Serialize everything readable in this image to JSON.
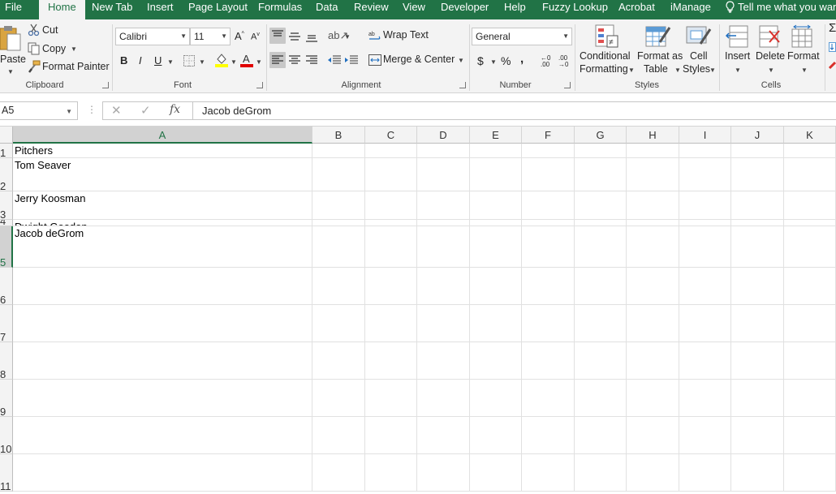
{
  "menu_tabs": [
    "File",
    "Home",
    "New Tab",
    "Insert",
    "Page Layout",
    "Formulas",
    "Data",
    "Review",
    "View",
    "Developer",
    "Help",
    "Fuzzy Lookup",
    "Acrobat",
    "iManage"
  ],
  "tell_me": "Tell me what you want to do",
  "ribbon": {
    "clipboard": {
      "paste": "Paste",
      "cut": "Cut",
      "copy": "Copy",
      "format_painter": "Format Painter",
      "label": "Clipboard"
    },
    "font": {
      "name": "Calibri",
      "size": "11",
      "grow": "A",
      "shrink": "A",
      "bold": "B",
      "italic": "I",
      "underline": "U",
      "label": "Font"
    },
    "alignment": {
      "wrap": "Wrap Text",
      "merge": "Merge & Center",
      "label": "Alignment"
    },
    "number": {
      "format": "General",
      "currency": "$",
      "percent": "%",
      "comma": ",",
      "label": "Number"
    },
    "styles": {
      "conditional": [
        "Conditional",
        "Formatting"
      ],
      "table": [
        "Format as",
        "Table"
      ],
      "cell": [
        "Cell",
        "Styles"
      ],
      "label": "Styles"
    },
    "cells": {
      "insert": "Insert",
      "delete": "Delete",
      "format": "Format",
      "label": "Cells"
    }
  },
  "formula_bar": {
    "name_box": "A5",
    "fx": "fx",
    "value": "Jacob deGrom"
  },
  "columns": [
    "A",
    "B",
    "C",
    "D",
    "E",
    "F",
    "G",
    "H",
    "I",
    "J",
    "K"
  ],
  "rows": [
    {
      "num": "1",
      "a": "Pitchers"
    },
    {
      "num": "2",
      "a": "Tom Seaver"
    },
    {
      "num": "3",
      "a": "Jerry Koosman"
    },
    {
      "num": "4",
      "a": "Dwight Gooden"
    },
    {
      "num": "5",
      "a": "Jacob deGrom"
    },
    {
      "num": "6",
      "a": ""
    },
    {
      "num": "7",
      "a": ""
    },
    {
      "num": "8",
      "a": ""
    },
    {
      "num": "9",
      "a": ""
    },
    {
      "num": "10",
      "a": ""
    },
    {
      "num": "11",
      "a": ""
    }
  ],
  "colors": {
    "excel_green": "#217346",
    "ribbon_bg": "#f3f3f3",
    "gridline": "#e1e1e1"
  }
}
